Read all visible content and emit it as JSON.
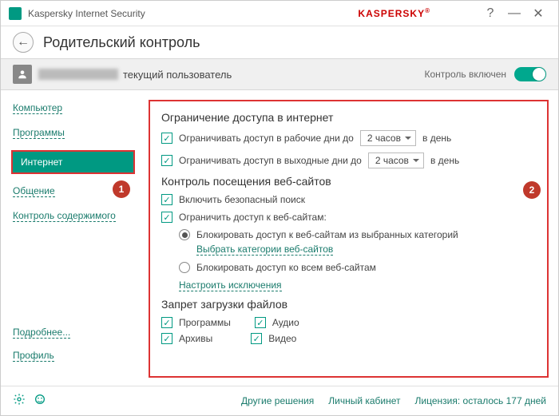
{
  "app": {
    "name": "Kaspersky Internet Security",
    "brand": "KASPERSKY"
  },
  "header": {
    "title": "Родительский контроль"
  },
  "userbar": {
    "current_user": "текущий пользователь",
    "control_label": "Контроль включен"
  },
  "sidebar": {
    "items": [
      {
        "label": "Компьютер"
      },
      {
        "label": "Программы"
      },
      {
        "label": "Интернет"
      },
      {
        "label": "Общение"
      },
      {
        "label": "Контроль содержимого"
      }
    ],
    "more": "Подробнее...",
    "profile": "Профиль"
  },
  "main": {
    "section1": {
      "title": "Ограничение доступа в интернет",
      "workdays": "Ограничивать доступ в рабочие дни до",
      "weekends": "Ограничивать доступ в выходные дни до",
      "dd_value": "2 часов",
      "per_day": "в день"
    },
    "section2": {
      "title": "Контроль посещения веб-сайтов",
      "safe_search": "Включить безопасный поиск",
      "restrict": "Ограничить доступ к веб-сайтам:",
      "radio1": "Блокировать доступ к веб-сайтам из выбранных категорий",
      "categories_link": "Выбрать категории веб-сайтов",
      "radio2": "Блокировать доступ ко всем веб-сайтам",
      "exceptions_link": "Настроить исключения"
    },
    "section3": {
      "title": "Запрет загрузки файлов",
      "c1": "Программы",
      "c2": "Аудио",
      "c3": "Архивы",
      "c4": "Видео"
    }
  },
  "badges": {
    "b1": "1",
    "b2": "2"
  },
  "footer": {
    "other": "Другие решения",
    "cabinet": "Личный кабинет",
    "license": "Лицензия: осталось 177 дней"
  }
}
